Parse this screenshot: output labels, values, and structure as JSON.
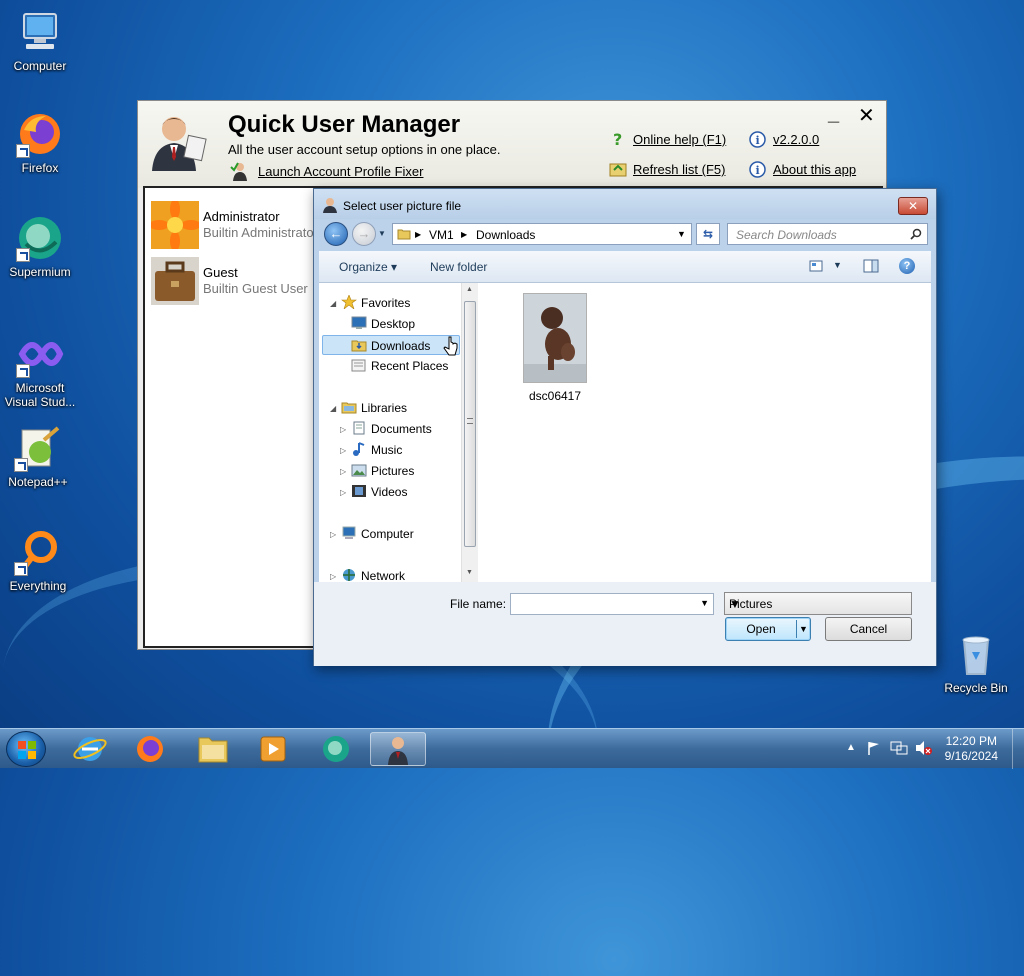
{
  "desktop": {
    "icons": [
      {
        "label": "Computer"
      },
      {
        "label": "Firefox"
      },
      {
        "label": "Supermium"
      },
      {
        "label": "Microsoft Visual Stud..."
      },
      {
        "label": "Notepad++"
      },
      {
        "label": "Everything"
      },
      {
        "label": "Recycle Bin"
      }
    ]
  },
  "qum": {
    "title": "Quick User Manager",
    "subtitle": "All the user account setup options in one place.",
    "launch_link": "Launch Account Profile Fixer",
    "online_help": "Online help (F1)",
    "refresh": "Refresh list (F5)",
    "version": "v2.2.0.0",
    "about": "About this app",
    "minimize": "_",
    "close": "✕",
    "users": [
      {
        "name": "Administrator",
        "desc": "Builtin Administrator"
      },
      {
        "name": "Guest",
        "desc": "Builtin Guest User"
      }
    ]
  },
  "dialog": {
    "title": "Select user picture file",
    "close": "✕",
    "path": [
      "VM1",
      "Downloads"
    ],
    "search_placeholder": "Search Downloads",
    "organize": "Organize",
    "new_folder": "New folder",
    "nav": {
      "favorites": "Favorites",
      "desktop": "Desktop",
      "downloads": "Downloads",
      "recent": "Recent Places",
      "libraries": "Libraries",
      "documents": "Documents",
      "music": "Music",
      "pictures": "Pictures",
      "videos": "Videos",
      "computer": "Computer",
      "network": "Network"
    },
    "files": [
      {
        "name": "dsc06417"
      }
    ],
    "filename_label": "File name:",
    "filename_value": "",
    "filetype": "Pictures",
    "open": "Open",
    "cancel": "Cancel"
  },
  "taskbar": {
    "time": "12:20 PM",
    "date": "9/16/2024"
  },
  "colors": {
    "accent": "#1e5fb0",
    "selection": "#cce4f7",
    "close_red": "#c84a34"
  }
}
